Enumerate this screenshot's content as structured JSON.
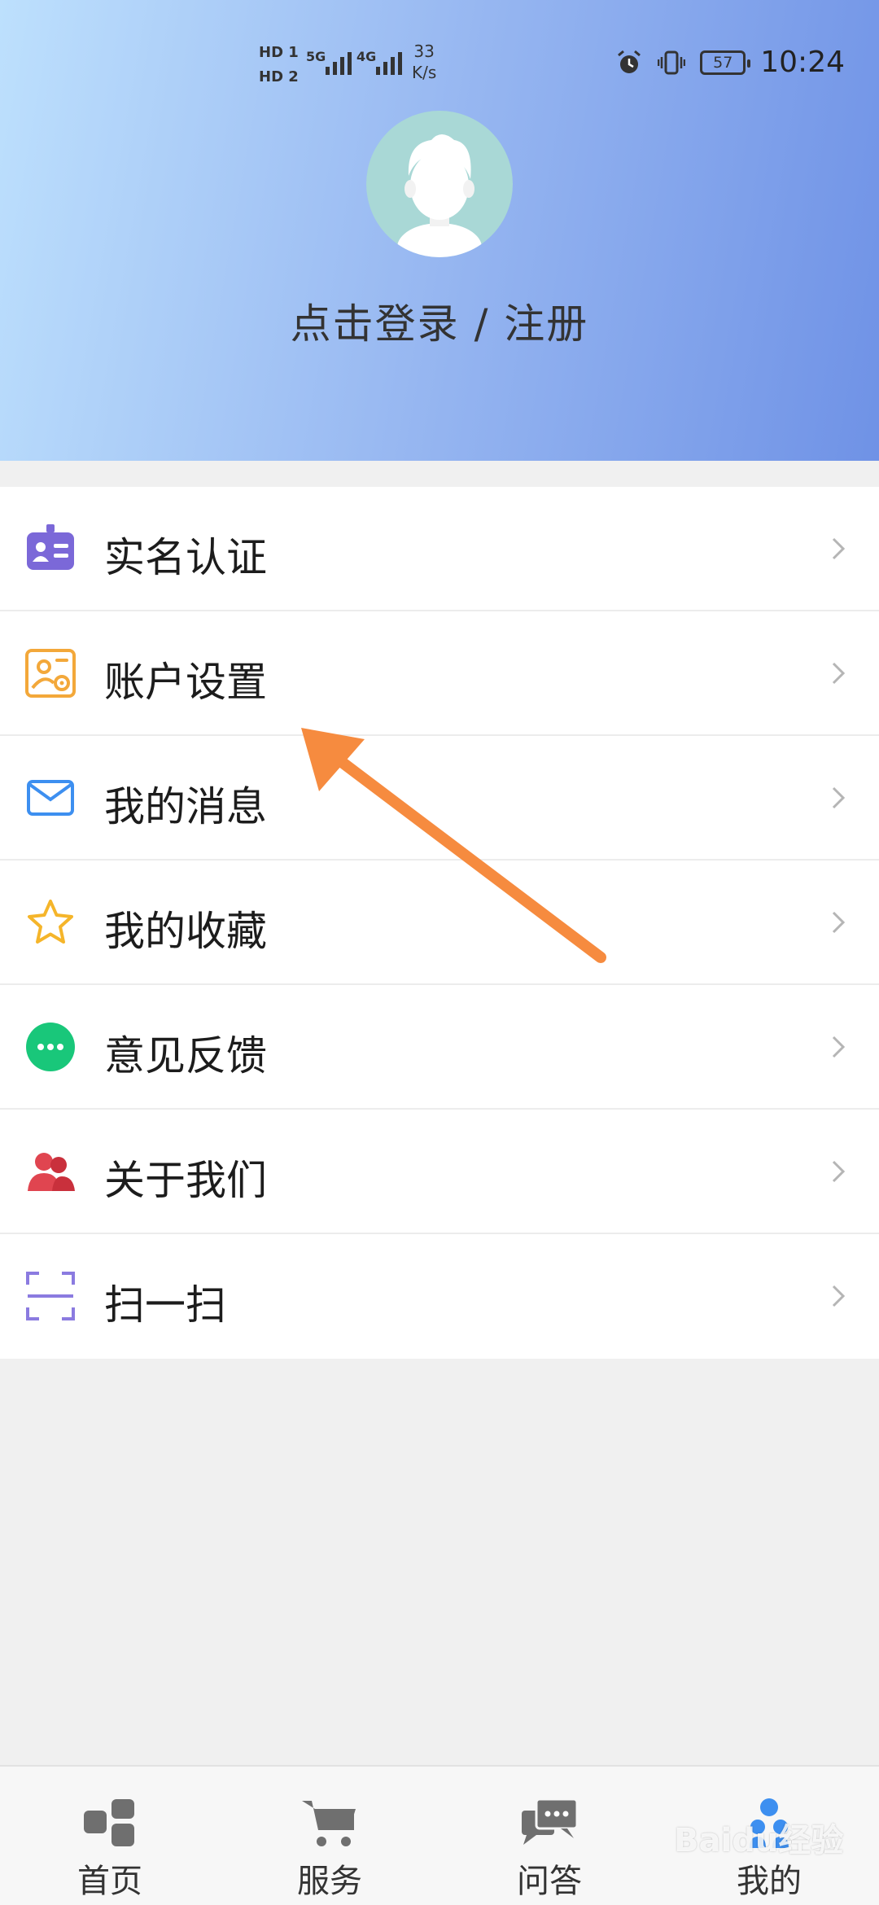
{
  "status_bar": {
    "hd1": "HD 1",
    "hd2": "HD 2",
    "net1": "5G",
    "net2": "4G",
    "speed_value": "33",
    "speed_unit": "K/s",
    "battery": "57",
    "time": "10:24"
  },
  "profile": {
    "login_label": "点击登录 / 注册"
  },
  "menu": {
    "items": [
      {
        "label": "实名认证",
        "icon": "id-card-icon",
        "color": "#7b68d8"
      },
      {
        "label": "账户设置",
        "icon": "account-settings-icon",
        "color": "#f3a83a"
      },
      {
        "label": "我的消息",
        "icon": "mail-icon",
        "color": "#3d8ff0"
      },
      {
        "label": "我的收藏",
        "icon": "star-icon",
        "color": "#f5b52a"
      },
      {
        "label": "意见反馈",
        "icon": "chat-bubble-icon",
        "color": "#19c77a"
      },
      {
        "label": "关于我们",
        "icon": "users-icon",
        "color": "#e04550"
      },
      {
        "label": "扫一扫",
        "icon": "scan-icon",
        "color": "#8b7be0"
      }
    ]
  },
  "tabbar": {
    "tabs": [
      {
        "label": "首页",
        "icon": "home-grid-icon"
      },
      {
        "label": "服务",
        "icon": "cart-icon"
      },
      {
        "label": "问答",
        "icon": "qa-chat-icon"
      },
      {
        "label": "我的",
        "icon": "profile-icon",
        "active": true
      }
    ]
  },
  "watermark": "Baidu经验",
  "colors": {
    "header_gradient_start": "#bde0fd",
    "header_gradient_end": "#6f92e6",
    "annotation_arrow": "#f68b3f",
    "active_tab": "#3d8ff0"
  }
}
